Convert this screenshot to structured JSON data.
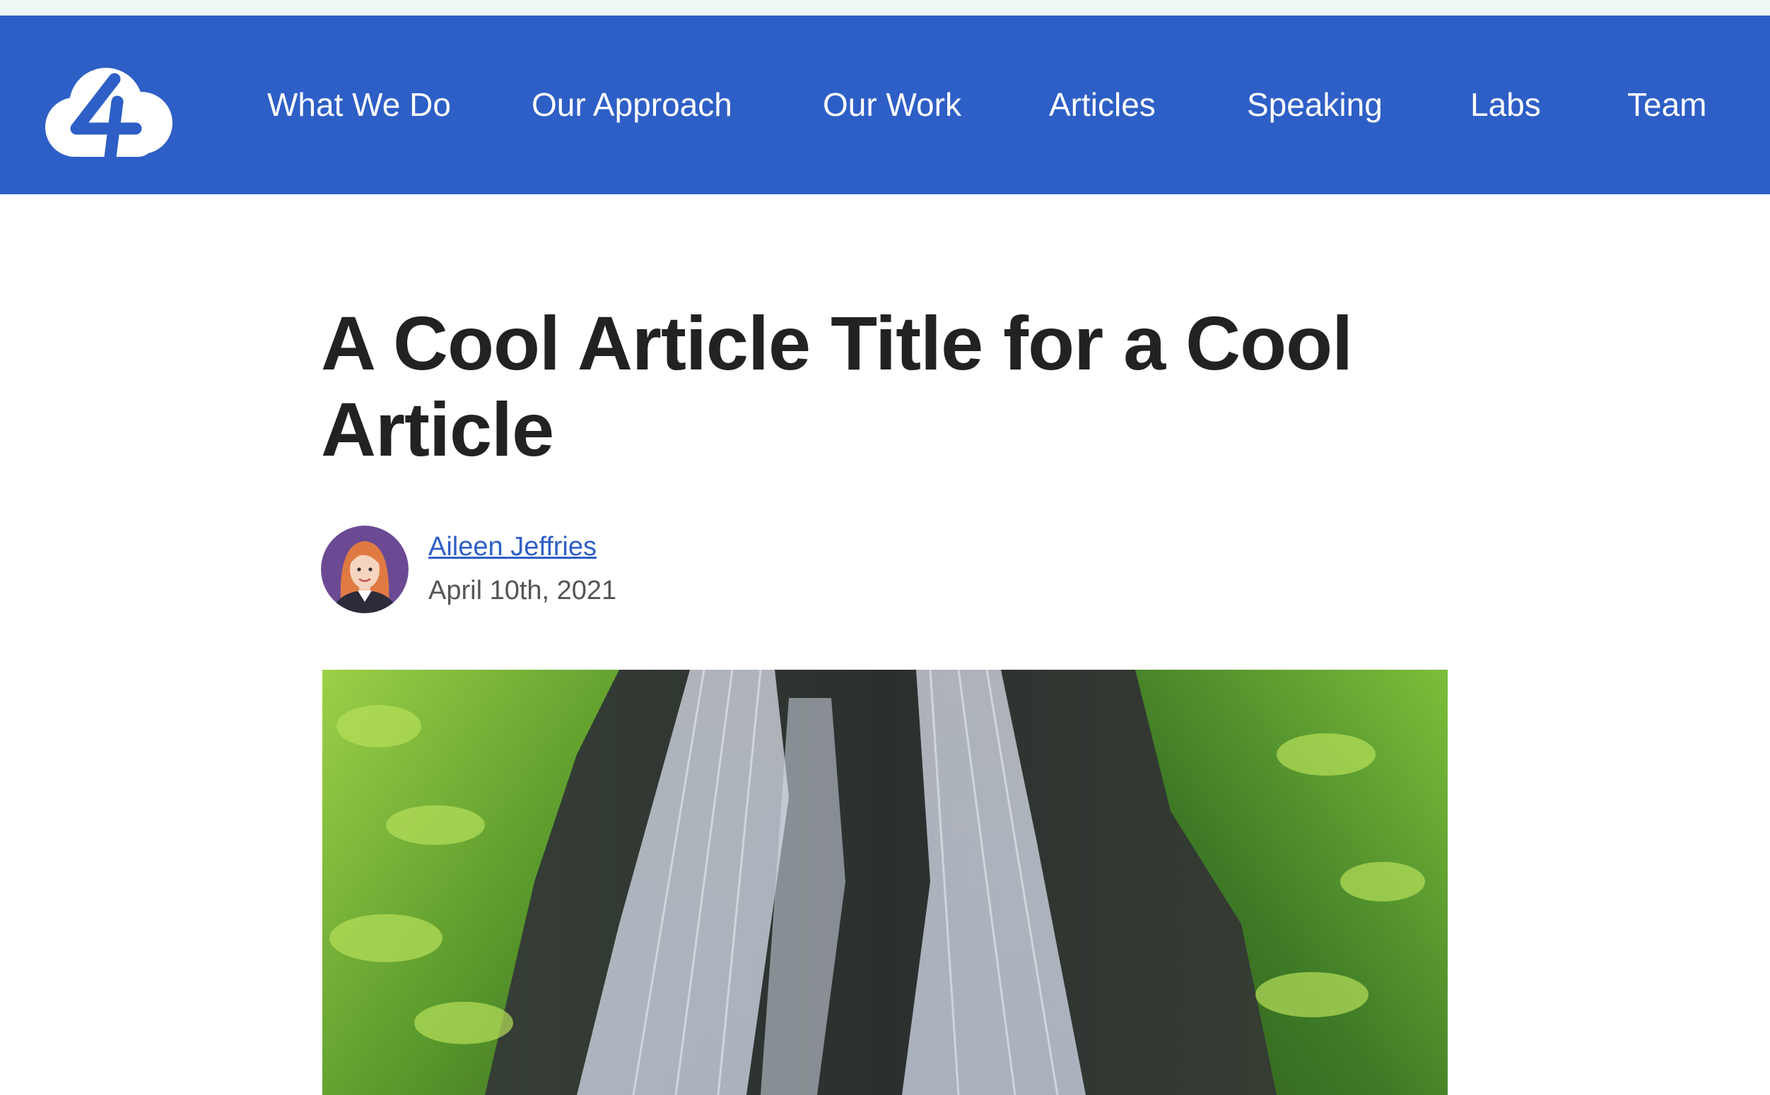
{
  "header": {
    "logo_icon": "four-cloud-logo-icon",
    "nav": [
      {
        "label": "What We Do"
      },
      {
        "label": "Our Approach"
      },
      {
        "label": "Our Work"
      },
      {
        "label": "Articles"
      },
      {
        "label": "Speaking"
      },
      {
        "label": "Labs"
      },
      {
        "label": "Team"
      }
    ]
  },
  "article": {
    "title": "A Cool Article Title for a Cool Article",
    "author": {
      "name": "Aileen Jeffries",
      "avatar_icon": "author-avatar-illustration"
    },
    "date": "April 10th, 2021",
    "hero_image": "waterfall-photo"
  },
  "colors": {
    "nav_background": "#2e5fc6",
    "nav_text": "#ffffff",
    "title_text": "#222222",
    "link": "#2e5fc6",
    "meta_text": "#555555",
    "avatar_background": "#6b4a93"
  }
}
